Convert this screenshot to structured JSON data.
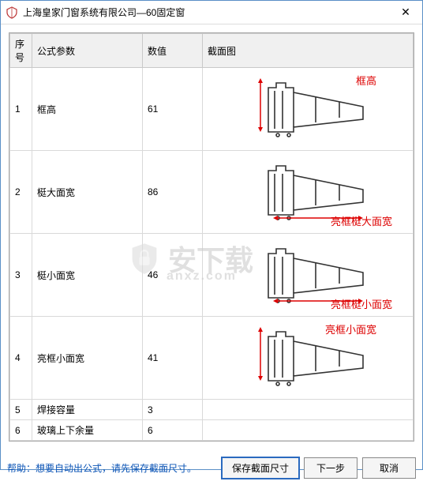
{
  "window": {
    "title": "上海皇家门窗系统有限公司—60固定窗"
  },
  "table": {
    "headers": {
      "index": "序号",
      "param": "公式参数",
      "value": "数值",
      "image": "截面图"
    },
    "rows": [
      {
        "idx": "1",
        "param": "框高",
        "value": "61",
        "diag_label": "框高",
        "label_top": true
      },
      {
        "idx": "2",
        "param": "梃大面宽",
        "value": "86",
        "diag_label": "亮框梃大面宽",
        "label_top": false
      },
      {
        "idx": "3",
        "param": "梃小面宽",
        "value": "46",
        "diag_label": "亮框梃小面宽",
        "label_top": false
      },
      {
        "idx": "4",
        "param": "亮框小面宽",
        "value": "41",
        "diag_label": "亮框小面宽",
        "label_top": true
      },
      {
        "idx": "5",
        "param": "焊接容量",
        "value": "3",
        "no_diag": true
      },
      {
        "idx": "6",
        "param": "玻璃上下余量",
        "value": "6",
        "no_diag": true
      }
    ]
  },
  "footer": {
    "help": "帮助：想要自动出公式，请先保存截面尺寸。",
    "save": "保存截面尺寸",
    "next": "下一步",
    "cancel": "取消"
  },
  "watermark": {
    "main": "安下载",
    "sub": "anxz.com"
  }
}
